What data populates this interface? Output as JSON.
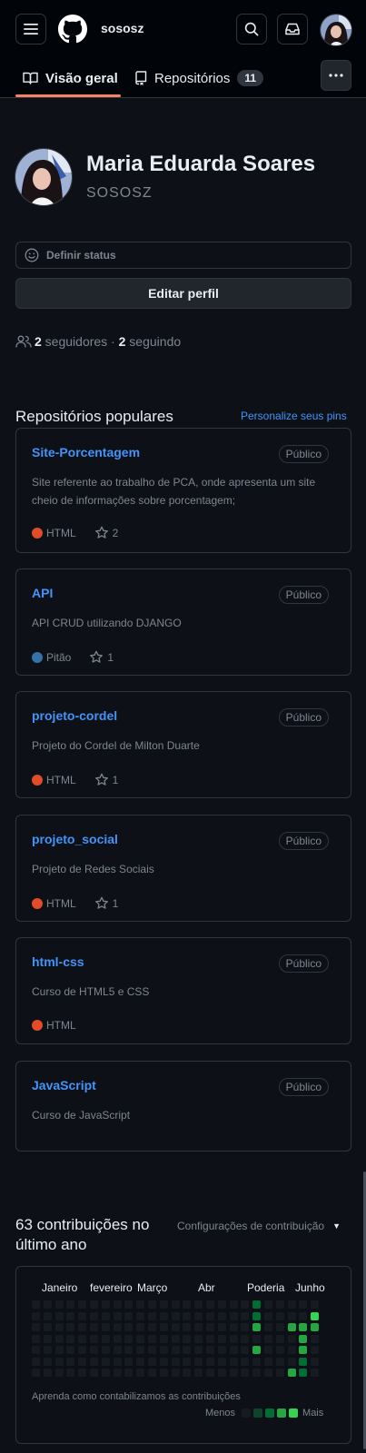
{
  "header": {
    "username": "sososz"
  },
  "tabs": [
    {
      "label": "Visão geral",
      "active": true
    },
    {
      "label": "Repositórios",
      "count": "11",
      "active": false
    }
  ],
  "profile": {
    "full_name": "Maria Eduarda Soares",
    "login": "SOSOSZ",
    "status_label": "Definir status",
    "edit_label": "Editar perfil",
    "followers_count": "2",
    "followers_label": " seguidores · ",
    "following_count": "2",
    "following_label": " seguindo"
  },
  "popular": {
    "title": "Repositórios populares",
    "customize_label": "Personalize seus pins",
    "repos": [
      {
        "name": "Site-Porcentagem",
        "visibility": "Público",
        "description": "Site referente ao trabalho de PCA, onde apresenta um site cheio de informações sobre porcentagem;",
        "language": "HTML",
        "language_color": "#e34c26",
        "stars": "2"
      },
      {
        "name": "API",
        "visibility": "Público",
        "description": "API CRUD utilizando DJANGO",
        "language": "Pitão",
        "language_color": "#3572a5",
        "stars": "1"
      },
      {
        "name": "projeto-cordel",
        "visibility": "Público",
        "description": "Projeto do Cordel de Milton Duarte",
        "language": "HTML",
        "language_color": "#e34c26",
        "stars": "1"
      },
      {
        "name": "projeto_social",
        "visibility": "Público",
        "description": "Projeto de Redes Sociais",
        "language": "HTML",
        "language_color": "#e34c26",
        "stars": "1"
      },
      {
        "name": "html-css",
        "visibility": "Público",
        "description": "Curso de HTML5 e CSS",
        "language": "HTML",
        "language_color": "#e34c26",
        "stars": null
      },
      {
        "name": "JavaScript",
        "visibility": "Público",
        "description": "Curso de JavaScript",
        "language": null,
        "language_color": null,
        "stars": null
      }
    ]
  },
  "contributions": {
    "title": "63 contribuições no último ano",
    "settings_label": "Configurações de contribuição",
    "months": [
      "Janeiro",
      "fevereiro",
      "Março",
      "Abr",
      "Poderia",
      "Junho"
    ],
    "learn_label": "Aprenda como contabilizamos as contribuições",
    "less_label": "Menos",
    "more_label": "Mais",
    "level_colors": [
      "#161b22",
      "#0e4429",
      "#006d32",
      "#26a641",
      "#39d353"
    ],
    "weeks": 25,
    "active_cells": [
      {
        "week": 19,
        "day": 0,
        "level": 2
      },
      {
        "week": 19,
        "day": 1,
        "level": 2
      },
      {
        "week": 19,
        "day": 2,
        "level": 3
      },
      {
        "week": 19,
        "day": 4,
        "level": 3
      },
      {
        "week": 22,
        "day": 2,
        "level": 3
      },
      {
        "week": 22,
        "day": 6,
        "level": 3
      },
      {
        "week": 23,
        "day": 2,
        "level": 3
      },
      {
        "week": 23,
        "day": 3,
        "level": 3
      },
      {
        "week": 23,
        "day": 4,
        "level": 3
      },
      {
        "week": 23,
        "day": 5,
        "level": 2
      },
      {
        "week": 23,
        "day": 6,
        "level": 2
      },
      {
        "week": 24,
        "day": 1,
        "level": 4
      },
      {
        "week": 24,
        "day": 2,
        "level": 3
      }
    ]
  }
}
